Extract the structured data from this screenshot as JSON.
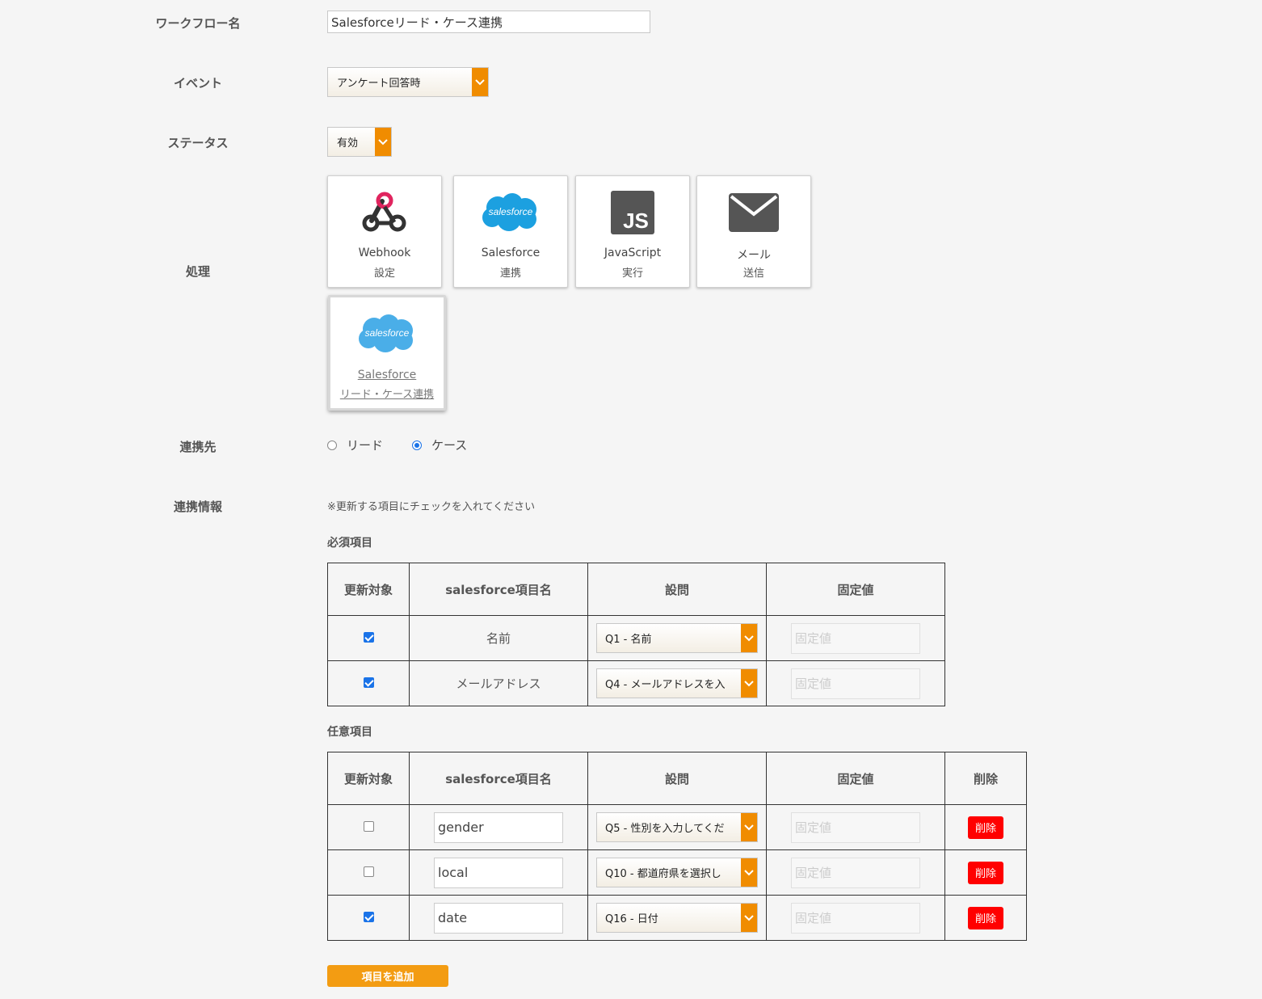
{
  "labels": {
    "workflow_name": "ワークフロー名",
    "event": "イベント",
    "status": "ステータス",
    "process": "処理",
    "target": "連携先",
    "info": "連携情報"
  },
  "workflow_name_value": "Salesforceリード・ケース連携",
  "event_value": "アンケート回答時",
  "status_value": "有効",
  "tiles": [
    {
      "line1": "Webhook",
      "line2": "設定",
      "icon": "webhook-icon"
    },
    {
      "line1": "Salesforce",
      "line2": "連携",
      "icon": "salesforce-icon"
    },
    {
      "line1": "JavaScript",
      "line2": "実行",
      "icon": "javascript-icon"
    },
    {
      "line1": "メール",
      "line2": "送信",
      "icon": "mail-icon"
    },
    {
      "line1": "Salesforce",
      "line2": "リード・ケース連携",
      "icon": "salesforce-icon",
      "selected": true
    }
  ],
  "salesforce_logo_text": "salesforce",
  "js_logo_text": "JS",
  "radio": {
    "lead": "リード",
    "case": "ケース",
    "selected": "case"
  },
  "note": "※更新する項目にチェックを入れてください",
  "required_heading": "必須項目",
  "optional_heading": "任意項目",
  "columns": {
    "update": "更新対象",
    "sf_name": "salesforce項目名",
    "question": "設問",
    "fixed": "固定値",
    "delete": "削除"
  },
  "fixed_placeholder": "固定値",
  "required_rows": [
    {
      "checked": true,
      "name": "名前",
      "question": "Q1 - 名前"
    },
    {
      "checked": true,
      "name": "メールアドレス",
      "question": "Q4 - メールアドレスを入"
    }
  ],
  "optional_rows": [
    {
      "checked": false,
      "name": "gender",
      "question": "Q5 - 性別を入力してくだ"
    },
    {
      "checked": false,
      "name": "local",
      "question": "Q10 - 都道府県を選択し"
    },
    {
      "checked": true,
      "name": "date",
      "question": "Q16 - 日付"
    }
  ],
  "delete_label": "削除",
  "add_button": "項目を追加",
  "colors": {
    "accent": "#f08c00",
    "delete": "#ff0000",
    "checkbox": "#1a73e8",
    "salesforce": "#1ca0e0"
  }
}
